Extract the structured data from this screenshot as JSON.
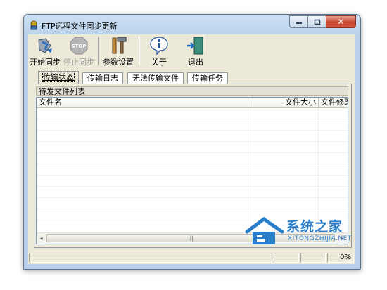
{
  "window": {
    "title": "FTP远程文件同步更新",
    "controls": {
      "minimize": "–",
      "maximize": "□",
      "close": "✕"
    }
  },
  "toolbar": {
    "start_sync": {
      "label": "开始同步",
      "icon": "sync-icon"
    },
    "stop_sync": {
      "label": "停止同步",
      "icon": "stop-icon"
    },
    "settings": {
      "label": "参数设置",
      "icon": "tools-icon"
    },
    "about": {
      "label": "关于",
      "icon": "info-icon"
    },
    "exit": {
      "label": "退出",
      "icon": "exit-door-icon"
    }
  },
  "tabs": [
    {
      "label": "传输状态",
      "active": true
    },
    {
      "label": "传输日志",
      "active": false
    },
    {
      "label": "无法传输文件",
      "active": false
    },
    {
      "label": "传输任务",
      "active": false
    }
  ],
  "panel": {
    "group_title": "待发文件列表",
    "columns": [
      "文件名",
      "文件大小",
      "文件修改"
    ]
  },
  "scrollbar": {
    "left": "◂",
    "right": "▸",
    "grip": "|||"
  },
  "status": {
    "progress": "0%"
  },
  "watermark": {
    "brand": "系统之家",
    "url": "XITONGZHIJIA.NET"
  }
}
